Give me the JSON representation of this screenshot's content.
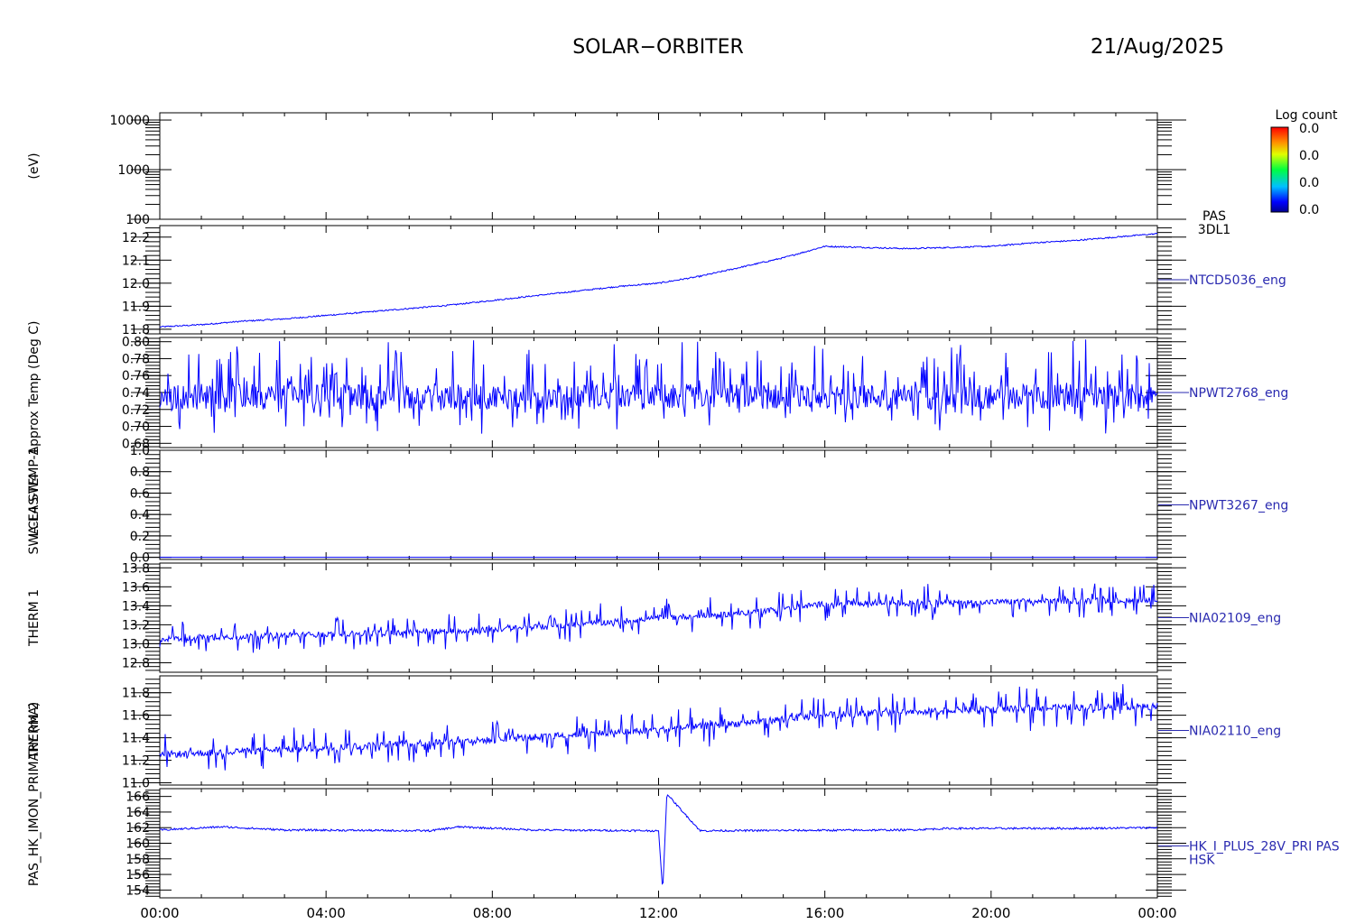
{
  "header": {
    "mission": "SOLAR−ORBITER",
    "date": "21/Aug/2025"
  },
  "colorbar": {
    "title": "Log count",
    "tick_labels": [
      "0.0",
      "0.0",
      "0.0",
      "0.0"
    ]
  },
  "colors": {
    "trace": "#0000ff",
    "axis": "#000000",
    "label": "#2a2ab0"
  },
  "x_axis": {
    "tick_labels": [
      "00:00",
      "04:00",
      "08:00",
      "12:00",
      "16:00",
      "20:00",
      "00:00"
    ]
  },
  "chart_data": [
    {
      "type": "heatmap",
      "name": "PAS 3DL1",
      "panel_label": [
        "PAS",
        "3DL1"
      ],
      "ylabel": "(eV)",
      "log_y": true,
      "ylim": [
        100,
        14000
      ],
      "y_tick_values": [
        100,
        1000,
        10000
      ],
      "y_tick_labels": [
        "100",
        "1000",
        "10000"
      ],
      "values": []
    },
    {
      "type": "line",
      "name": "NTCD5036_eng",
      "panel_label": [
        "NTCD5036_eng"
      ],
      "ylabel": "Approx Temp (Deg C)",
      "ylim": [
        11.78,
        12.25
      ],
      "y_tick_values": [
        11.8,
        11.9,
        12.0,
        12.1,
        12.2
      ],
      "y_tick_labels": [
        "11.8",
        "11.9",
        "12.0",
        "12.1",
        "12.2"
      ],
      "x_hours": [
        0,
        1,
        2,
        3,
        4,
        5,
        6,
        7,
        8,
        9,
        10,
        11,
        12,
        13,
        14,
        15,
        16,
        17,
        18,
        19,
        20,
        21,
        22,
        23,
        24
      ],
      "values": [
        11.81,
        11.82,
        11.835,
        11.845,
        11.86,
        11.875,
        11.89,
        11.905,
        11.925,
        11.945,
        11.965,
        11.985,
        12.0,
        12.03,
        12.07,
        12.11,
        12.16,
        12.155,
        12.15,
        12.155,
        12.16,
        12.175,
        12.185,
        12.2,
        12.215
      ]
    },
    {
      "type": "line",
      "name": "NPWT2768_eng",
      "panel_label": [
        "NPWT2768_eng"
      ],
      "ylabel": "SWA-EAS-TEMP-1",
      "ylim": [
        0.675,
        0.805
      ],
      "y_tick_values": [
        0.68,
        0.7,
        0.72,
        0.74,
        0.76,
        0.78,
        0.8
      ],
      "y_tick_labels": [
        "0.68",
        "0.70",
        "0.72",
        "0.74",
        "0.76",
        "0.78",
        "0.80"
      ],
      "x_hours": [
        0,
        24
      ],
      "values": [
        0.735,
        0.735
      ],
      "scatter_min": 0.69,
      "scatter_max": 0.8
    },
    {
      "type": "line",
      "name": "NPWT3267_eng",
      "panel_label": [
        "NPWT3267_eng"
      ],
      "ylabel": "LCL4 SW4",
      "ylim": [
        -0.02,
        1.0
      ],
      "y_tick_values": [
        0.0,
        0.2,
        0.4,
        0.6,
        0.8,
        1.0
      ],
      "y_tick_labels": [
        "0.0",
        "0.2",
        "0.4",
        "0.6",
        "0.8",
        "1.0"
      ],
      "x_hours": [
        0,
        24
      ],
      "values": [
        0.0,
        0.0
      ]
    },
    {
      "type": "line",
      "name": "NIA02109_eng",
      "panel_label": [
        "NIA02109_eng"
      ],
      "ylabel": "THERM 1",
      "ylim": [
        12.7,
        13.85
      ],
      "y_tick_values": [
        12.8,
        13.0,
        13.2,
        13.4,
        13.6,
        13.8
      ],
      "y_tick_labels": [
        "12.8",
        "13.0",
        "13.2",
        "13.4",
        "13.6",
        "13.8"
      ],
      "x_hours": [
        0,
        2,
        4,
        6,
        8,
        10,
        12,
        14,
        16,
        18,
        20,
        22,
        24
      ],
      "values": [
        13.05,
        13.08,
        13.1,
        13.12,
        13.15,
        13.2,
        13.27,
        13.32,
        13.42,
        13.43,
        13.44,
        13.45,
        13.46
      ]
    },
    {
      "type": "line",
      "name": "NIA02110_eng",
      "panel_label": [
        "NIA02110_eng"
      ],
      "ylabel": "THERM 2",
      "ylim": [
        10.98,
        11.95
      ],
      "y_tick_values": [
        11.0,
        11.2,
        11.4,
        11.6,
        11.8
      ],
      "y_tick_labels": [
        "11.0",
        "11.2",
        "11.4",
        "11.6",
        "11.8"
      ],
      "x_hours": [
        0,
        2,
        4,
        6,
        8,
        10,
        12,
        14,
        16,
        18,
        20,
        22,
        24
      ],
      "values": [
        11.25,
        11.28,
        11.31,
        11.35,
        11.38,
        11.43,
        11.47,
        11.53,
        11.6,
        11.63,
        11.65,
        11.67,
        11.68
      ]
    },
    {
      "type": "line",
      "name": "HK_I_PLUS_28V_PRI PAS HSK",
      "panel_label": [
        "HK_I_PLUS_28V_PRI PAS",
        "HSK"
      ],
      "ylabel": "PAS_HK_IMON_PRIMARY (mA)",
      "ylim": [
        153,
        167
      ],
      "y_tick_values": [
        154,
        156,
        158,
        160,
        162,
        164,
        166
      ],
      "y_tick_labels": [
        "154",
        "156",
        "158",
        "160",
        "162",
        "164",
        "166"
      ],
      "x_hours": [
        0,
        1.5,
        3,
        6.5,
        7.2,
        9,
        12.0,
        12.1,
        12.2,
        13,
        18,
        19,
        22,
        24
      ],
      "values": [
        161.7,
        162.1,
        161.7,
        161.6,
        162.1,
        161.7,
        161.6,
        153.8,
        166.3,
        161.6,
        161.7,
        161.9,
        161.9,
        162.0
      ]
    }
  ]
}
